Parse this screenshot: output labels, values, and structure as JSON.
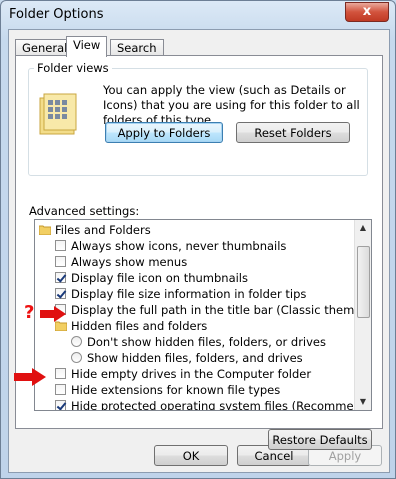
{
  "window": {
    "title": "Folder Options",
    "close_glyph": "x"
  },
  "tabs": [
    {
      "label": "General"
    },
    {
      "label": "View"
    },
    {
      "label": "Search"
    }
  ],
  "folder_views": {
    "legend": "Folder views",
    "description": "You can apply the view (such as Details or Icons) that you are using for this folder to all folders of this type.",
    "apply_button": "Apply to Folders",
    "reset_button": "Reset Folders"
  },
  "advanced": {
    "label": "Advanced settings:",
    "items": [
      {
        "type": "folder",
        "label": "Files and Folders"
      },
      {
        "type": "checkbox",
        "label": "Always show icons, never thumbnails",
        "checked": false
      },
      {
        "type": "checkbox",
        "label": "Always show menus",
        "checked": false
      },
      {
        "type": "checkbox",
        "label": "Display file icon on thumbnails",
        "checked": true
      },
      {
        "type": "checkbox",
        "label": "Display file size information in folder tips",
        "checked": true
      },
      {
        "type": "checkbox",
        "label": "Display the full path in the title bar (Classic theme only)",
        "checked": false
      },
      {
        "type": "folder",
        "label": "Hidden files and folders"
      },
      {
        "type": "radio",
        "label": "Don't show hidden files, folders, or drives",
        "checked": false
      },
      {
        "type": "radio",
        "label": "Show hidden files, folders, and drives",
        "checked": false
      },
      {
        "type": "checkbox",
        "label": "Hide empty drives in the Computer folder",
        "checked": false
      },
      {
        "type": "checkbox",
        "label": "Hide extensions for known file types",
        "checked": false
      },
      {
        "type": "checkbox",
        "label": "Hide protected operating system files (Recommended)",
        "checked": true
      }
    ]
  },
  "annotations": {
    "question_mark": "?"
  },
  "buttons": {
    "restore_defaults": "Restore Defaults",
    "ok": "OK",
    "cancel": "Cancel",
    "apply": "Apply"
  },
  "colors": {
    "annotation_red": "#e01010",
    "accent_blue": "#3c7fb1"
  }
}
